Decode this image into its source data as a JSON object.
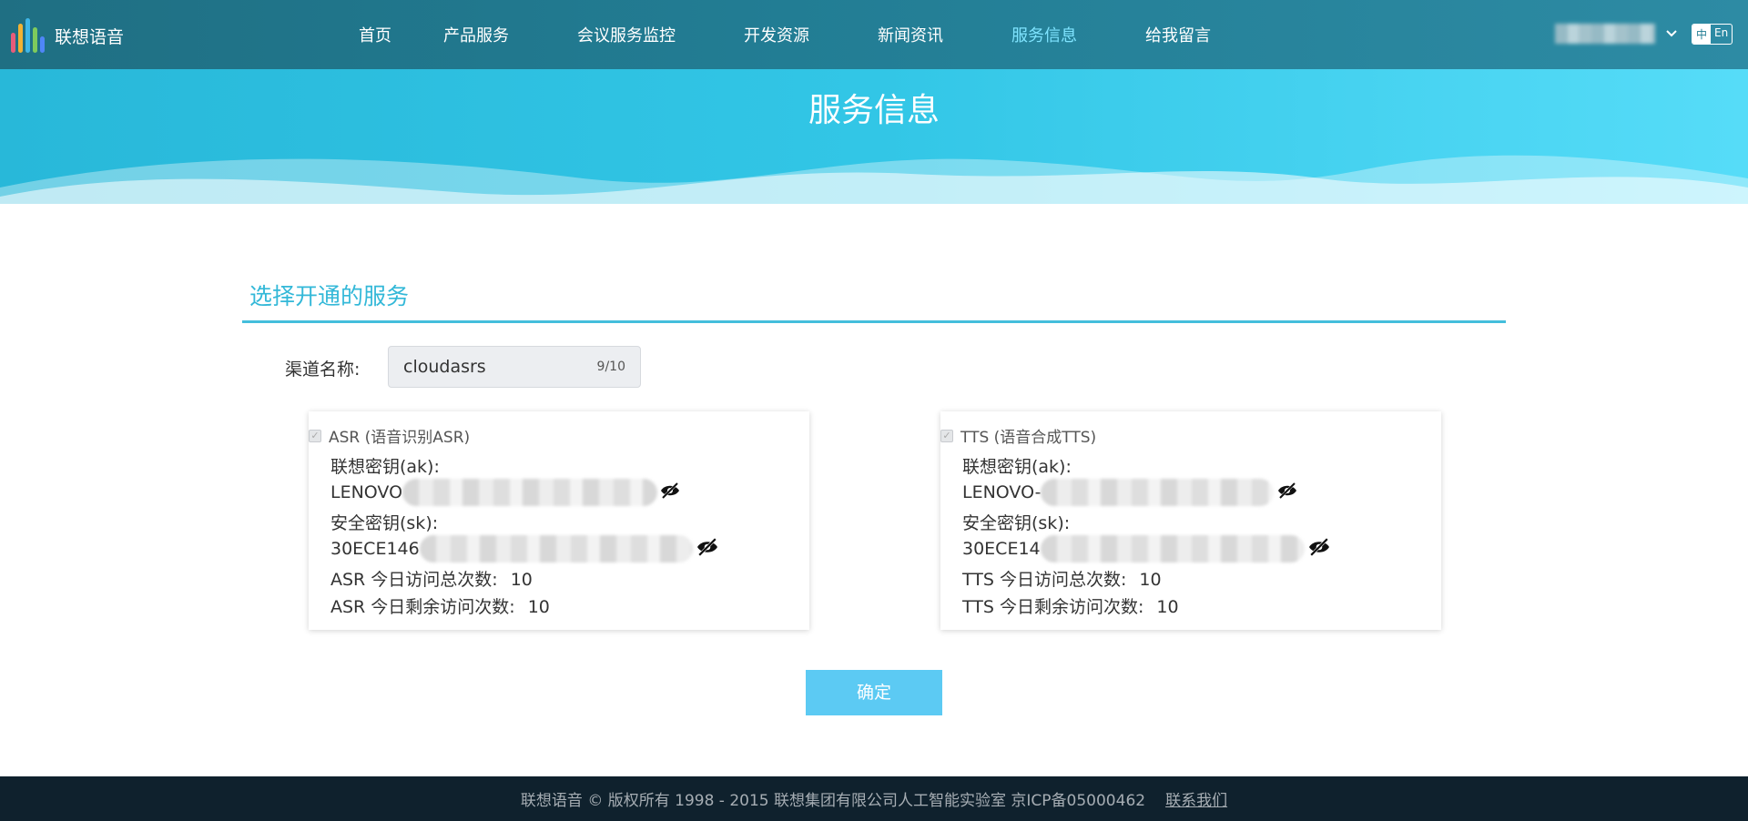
{
  "header": {
    "logo_text": "联想语音",
    "logo_bar_colors": [
      "#e85c7a",
      "#f2b233",
      "#3fb6e8",
      "#7ecb5c",
      "#4f86f7"
    ],
    "nav": [
      {
        "label": "首页"
      },
      {
        "label": "产品服务"
      },
      {
        "label": "会议服务监控"
      },
      {
        "label": "开发资源"
      },
      {
        "label": "新闻资讯"
      },
      {
        "label": "服务信息",
        "active": true
      },
      {
        "label": "给我留言"
      }
    ],
    "lang_zh": "中",
    "lang_en": "En"
  },
  "banner": {
    "title": "服务信息"
  },
  "section": {
    "title": "选择开通的服务"
  },
  "channel": {
    "label": "渠道名称:",
    "value": "cloudasrs",
    "count": "9/10"
  },
  "asr": {
    "checkbox_label": "ASR (语音识别ASR)",
    "ak_label": "联想密钥(ak):",
    "ak_value": "LENOVO",
    "sk_label": "安全密钥(sk):",
    "sk_value": "30ECE146",
    "total_label": "ASR 今日访问总次数:",
    "total_value": "10",
    "remain_label": "ASR 今日剩余访问次数:",
    "remain_value": "10"
  },
  "tts": {
    "checkbox_label": "TTS (语音合成TTS)",
    "ak_label": "联想密钥(ak):",
    "ak_value": "LENOVO-",
    "sk_label": "安全密钥(sk):",
    "sk_value": "30ECE14",
    "total_label": "TTS 今日访问总次数:",
    "total_value": "10",
    "remain_label": "TTS 今日剩余访问次数:",
    "remain_value": "10"
  },
  "confirm_label": "确定",
  "footer": {
    "copyright": "联想语音 © 版权所有 1998 - 2015 联想集团有限公司人工智能实验室 京ICP备05000462",
    "contact": "联系我们"
  },
  "colors": {
    "accent": "#33b8d8",
    "button": "#5ccaf3",
    "footer_bg": "#0f212d"
  }
}
